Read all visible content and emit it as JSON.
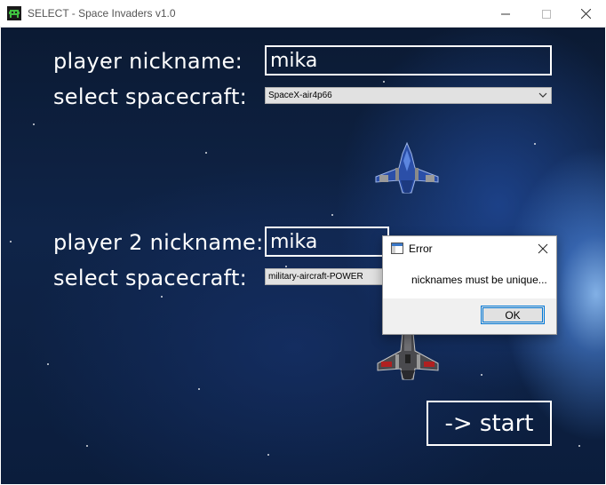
{
  "window": {
    "title": "SELECT - Space Invaders v1.0",
    "icon": "space-invader-icon",
    "controls": {
      "minimize": "minimize-icon",
      "maximize": "maximize-icon",
      "close": "close-icon"
    }
  },
  "player1": {
    "nickname_label": "player nickname:",
    "nickname_value": "mika",
    "spacecraft_label": "select spacecraft:",
    "spacecraft_value": "SpaceX-air4p66"
  },
  "player2": {
    "nickname_label": "player 2 nickname:",
    "nickname_value": "mika",
    "spacecraft_label": "select spacecraft:",
    "spacecraft_value": "military-aircraft-POWER"
  },
  "start_button": "-> start",
  "dialog": {
    "title": "Error",
    "message": "nicknames must be unique...",
    "ok_label": "OK"
  },
  "colors": {
    "accent": "#0078d7",
    "text_on_space": "#ffffff",
    "space_dark": "#0b1a33"
  }
}
